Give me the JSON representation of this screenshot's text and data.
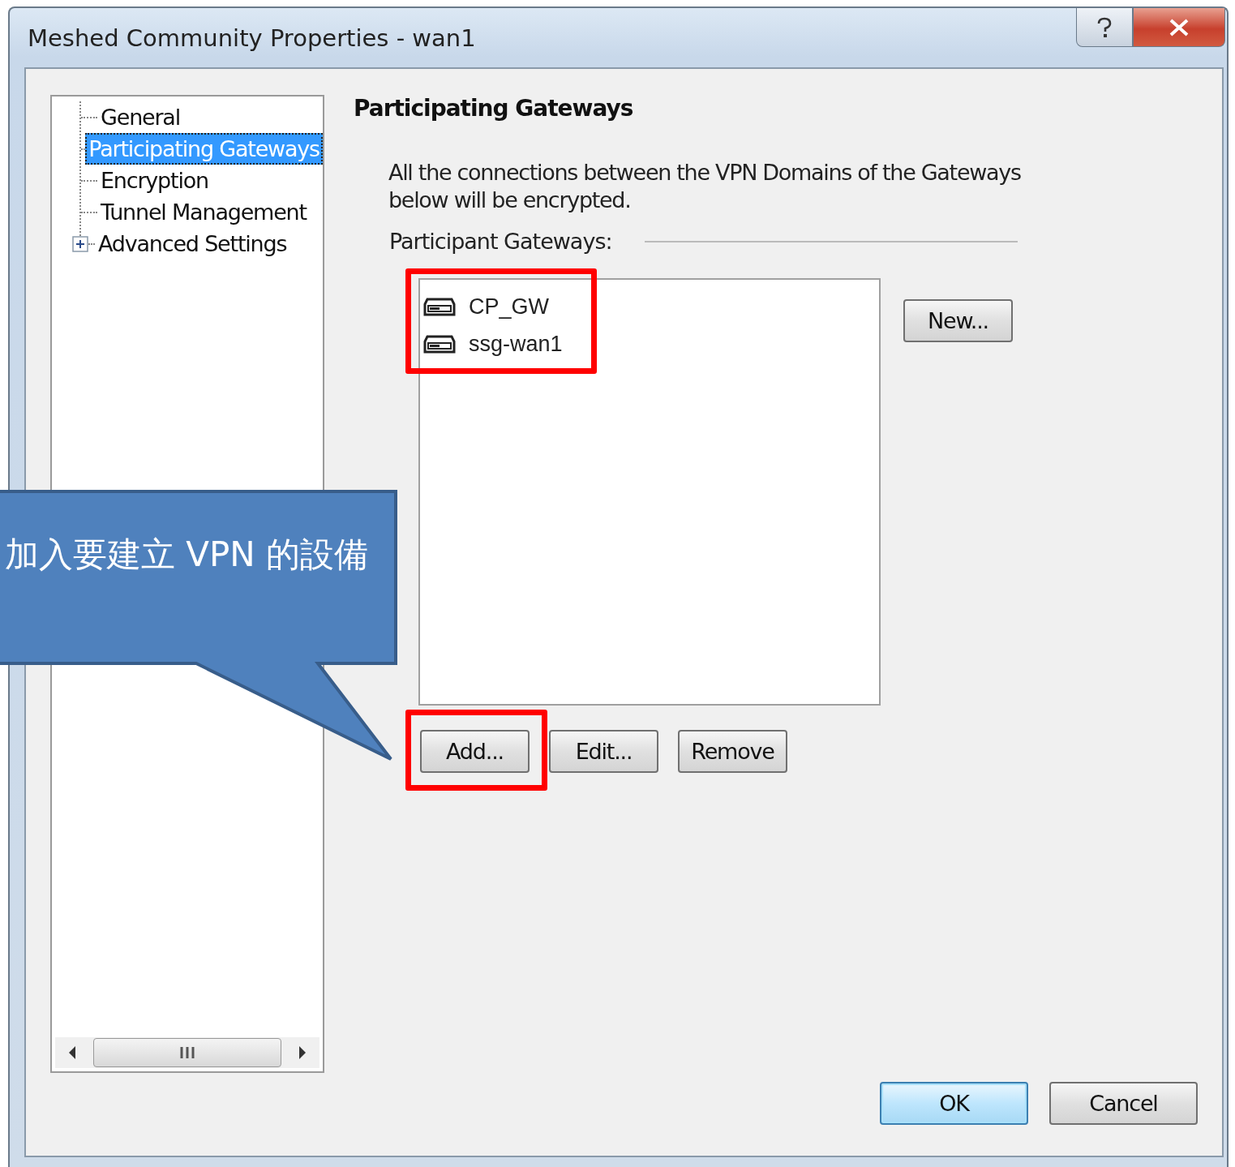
{
  "window": {
    "title": "Meshed Community Properties - wan1"
  },
  "tree": {
    "items": [
      {
        "label": "General",
        "selected": false
      },
      {
        "label": "Participating Gateways",
        "selected": true
      },
      {
        "label": "Encryption",
        "selected": false
      },
      {
        "label": "Tunnel Management",
        "selected": false
      },
      {
        "label": "Advanced Settings",
        "selected": false,
        "expanded": false
      }
    ]
  },
  "page": {
    "heading": "Participating Gateways",
    "description": "All the connections between the VPN Domains of the Gateways below will be encrypted.",
    "list_label": "Participant Gateways:",
    "gateways": [
      {
        "name": "CP_GW"
      },
      {
        "name": "ssg-wan1"
      }
    ],
    "side_button": "New...",
    "list_buttons": [
      "Add...",
      "Edit...",
      "Remove"
    ]
  },
  "buttons": [
    {
      "label": "OK",
      "default": true
    },
    {
      "label": "Cancel",
      "default": false
    }
  ],
  "callout": {
    "text": "加入要建立 VPN 的設備"
  }
}
